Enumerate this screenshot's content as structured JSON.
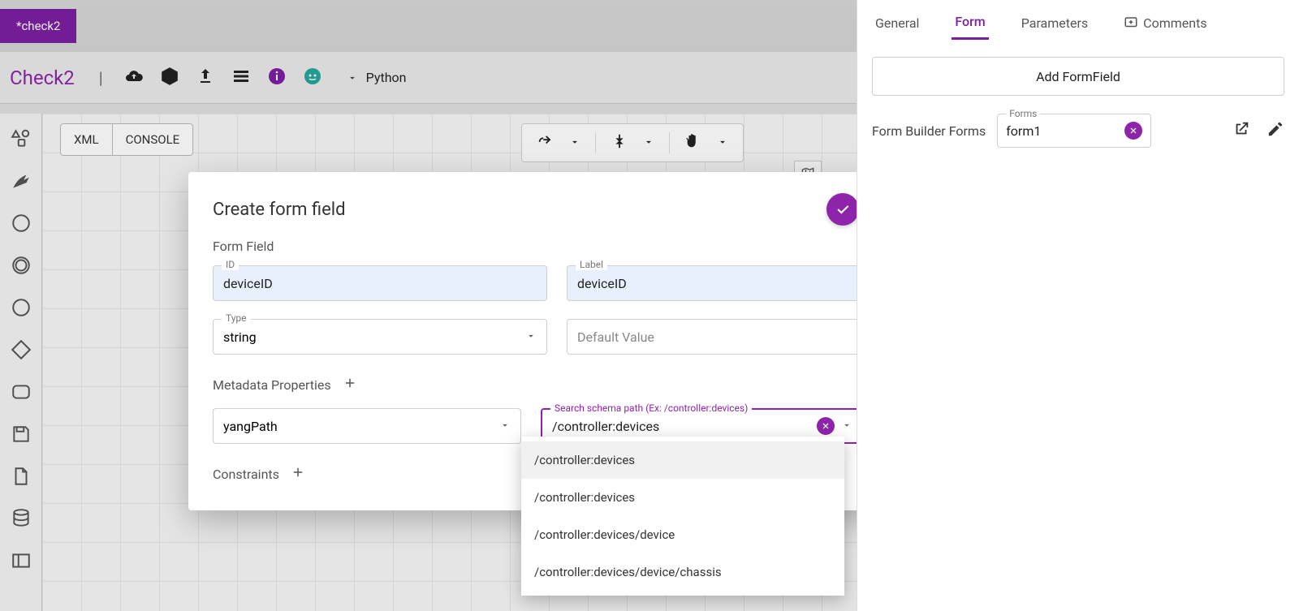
{
  "file_tab": "*check2",
  "page_title": "Check2",
  "language": "Python",
  "view_tabs": [
    "XML",
    "CONSOLE"
  ],
  "side": {
    "tabs": {
      "general": "General",
      "form": "Form",
      "parameters": "Parameters",
      "comments": "Comments"
    },
    "add_btn": "Add FormField",
    "builder_label": "Form Builder Forms",
    "forms_float": "Forms",
    "forms_value": "form1"
  },
  "modal": {
    "title": "Create form field",
    "section_formfield": "Form Field",
    "id_float": "ID",
    "id_value": "deviceID",
    "label_float": "Label",
    "label_value": "deviceID",
    "type_float": "Type",
    "type_value": "string",
    "default_placeholder": "Default Value",
    "meta_header": "Metadata Properties",
    "yang_value": "yangPath",
    "schema_float": "Search schema path (Ex: /controller:devices)",
    "schema_value": "/controller:devices",
    "constraints_header": "Constraints"
  },
  "dropdown": {
    "options": [
      "/controller:devices",
      "/controller:devices",
      "/controller:devices/device",
      "/controller:devices/device/chassis"
    ]
  }
}
